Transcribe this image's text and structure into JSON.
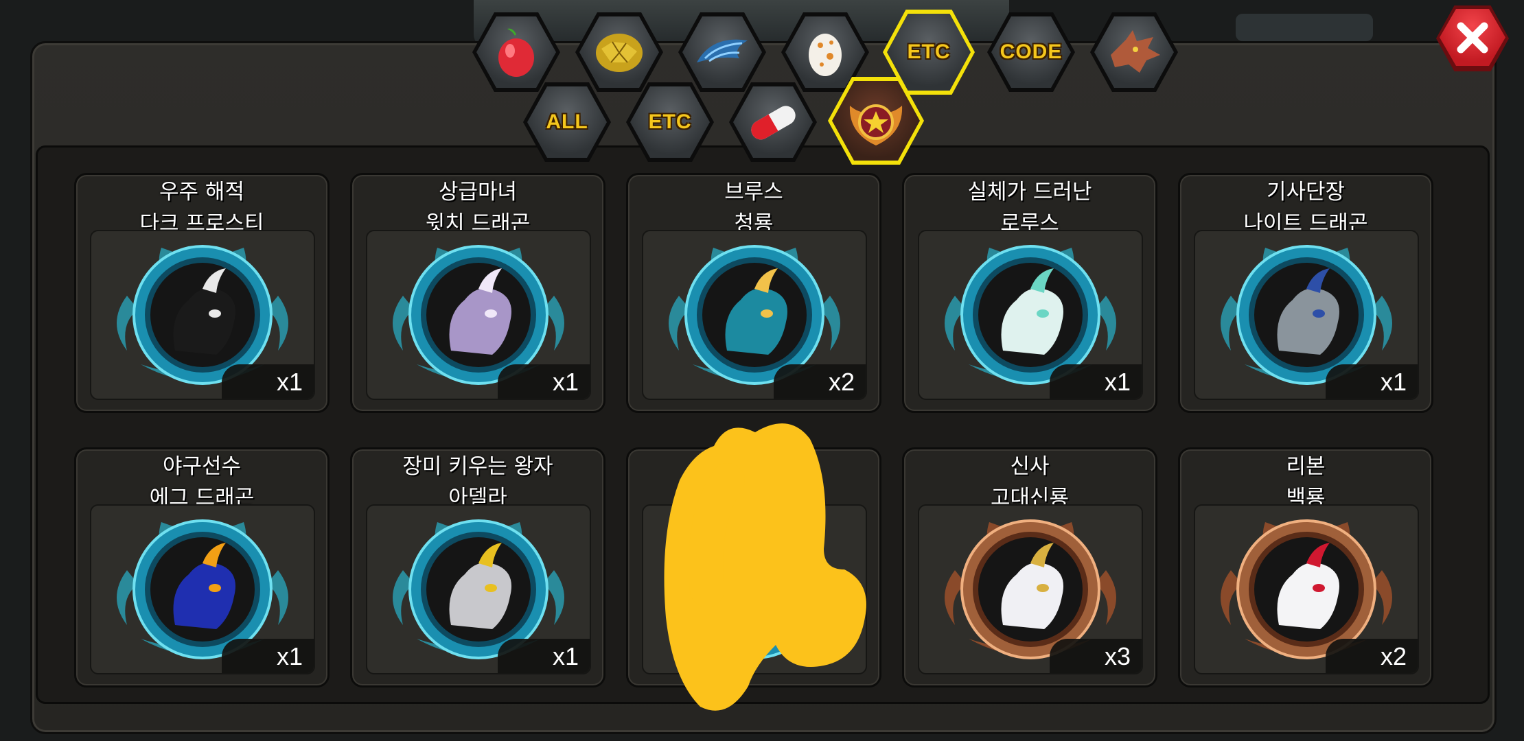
{
  "tabs_row1": [
    {
      "id": "fruit",
      "icon": "red-fruit-icon"
    },
    {
      "id": "stone",
      "icon": "gold-egg-stone-icon"
    },
    {
      "id": "scale",
      "icon": "blue-wing-icon"
    },
    {
      "id": "egg",
      "icon": "spotted-egg-icon"
    },
    {
      "id": "etc",
      "label": "ETC",
      "selected": true
    },
    {
      "id": "code",
      "label": "CODE"
    },
    {
      "id": "dragon",
      "icon": "dragon-head-icon"
    }
  ],
  "tabs_row2": [
    {
      "id": "all",
      "label": "ALL"
    },
    {
      "id": "etc2",
      "label": "ETC"
    },
    {
      "id": "pill",
      "icon": "pill-icon"
    },
    {
      "id": "emblem",
      "icon": "star-emblem-icon",
      "selected": true
    }
  ],
  "items": [
    {
      "title": "우주 해적\n다크 프로스티",
      "qty": "x1",
      "frame": "blue",
      "portrait": "#1a1a1a",
      "accent": "#e8e8e8"
    },
    {
      "title": "상급마녀\n윗치 드래곤",
      "qty": "x1",
      "frame": "blue",
      "portrait": "#a896c8",
      "accent": "#f0e8f8"
    },
    {
      "title": "브루스\n청룡",
      "qty": "x2",
      "frame": "blue",
      "portrait": "#1c8aa0",
      "accent": "#f2c24a"
    },
    {
      "title": "실체가 드러난\n로루스",
      "qty": "x1",
      "frame": "blue",
      "portrait": "#dff2ee",
      "accent": "#6bd6c4"
    },
    {
      "title": "기사단장\n나이트 드래곤",
      "qty": "x1",
      "frame": "blue",
      "portrait": "#8a949c",
      "accent": "#2d4fa8"
    },
    {
      "title": "야구선수\n에그 드래곤",
      "qty": "x1",
      "frame": "blue",
      "portrait": "#1f2fb0",
      "accent": "#f2a015"
    },
    {
      "title": "장미 키우는 왕자\n아델라",
      "qty": "x1",
      "frame": "blue",
      "portrait": "#c8c8cc",
      "accent": "#e8c020"
    },
    {
      "title": "",
      "qty": "",
      "frame": "blue",
      "portrait": "#1c8aa0",
      "accent": "#1c8aa0",
      "obscured": true
    },
    {
      "title": "신사\n고대신룡",
      "qty": "x3",
      "frame": "bronze",
      "portrait": "#f0f0f4",
      "accent": "#d8b040"
    },
    {
      "title": "리본\n백룡",
      "qty": "x2",
      "frame": "bronze",
      "portrait": "#f4f4f6",
      "accent": "#d01830"
    }
  ],
  "colors": {
    "selected_border": "#f4e10a",
    "tab_text": "#f5c71d",
    "close_button": "#d8222a",
    "scribble": "#fcc21b"
  }
}
